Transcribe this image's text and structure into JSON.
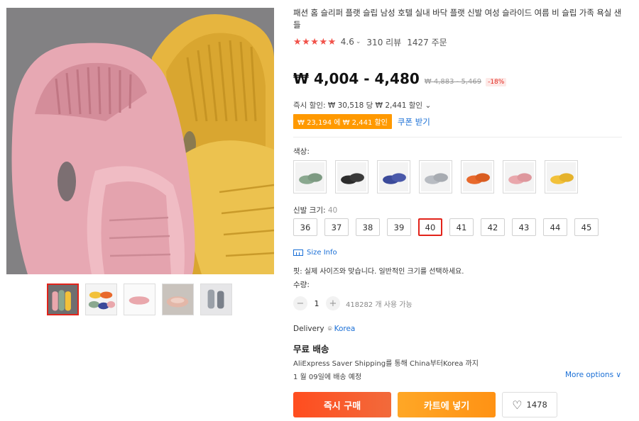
{
  "product": {
    "title": "패션 홈 슬리퍼 플랫 슬립 남성 호텔 실내 바닥 플랫 신발 여성 슬라이드 여름 비 슬립 가족 욕실 샌들",
    "stars_icon": "star-icon",
    "rating": "4.6",
    "reviews": "310 리뷰",
    "orders": "1427 주문"
  },
  "price": {
    "current": "₩ 4,004 - 4,480",
    "original": "₩ 4,883 - 5,469",
    "discount": "-18%",
    "instant_discount": "즉시 할인: ₩ 30,518 당 ₩ 2,441 할인",
    "coupon_tag": "₩ 23,194 에 ₩ 2,441 할인",
    "coupon_link": "쿠폰 받기",
    "accent_color": "#e2231a",
    "coupon_color": "#ff9900"
  },
  "color": {
    "label": "색상:",
    "options": [
      {
        "name": "green",
        "color": "#8aa88f"
      },
      {
        "name": "black",
        "color": "#2b2b2b"
      },
      {
        "name": "navy",
        "color": "#3b4a9a"
      },
      {
        "name": "grey",
        "color": "#b8bcc2"
      },
      {
        "name": "orange",
        "color": "#e8692c"
      },
      {
        "name": "pink",
        "color": "#e9a7ac"
      },
      {
        "name": "yellow",
        "color": "#f2c13a"
      }
    ]
  },
  "size": {
    "label": "신발 크기: ",
    "selected": "40",
    "options": [
      "36",
      "37",
      "38",
      "39",
      "40",
      "41",
      "42",
      "43",
      "44",
      "45"
    ],
    "info_link": "Size Info",
    "fit_note": "핏: 실제 사이즈와 맞습니다. 일반적인 크기를 선택하세요."
  },
  "quantity": {
    "label": "수량:",
    "value": "1",
    "minus": "−",
    "plus": "+",
    "available": "418282 개 사용 가능"
  },
  "delivery": {
    "label": "Delivery",
    "location": "Korea",
    "free_shipping": "무료 배송",
    "via": "AliExpress Saver Shipping를 통해 China부터Korea 까지",
    "date": "1 월 09일에 배송 예정",
    "more_options": "More options ∨"
  },
  "actions": {
    "buy_now": "즉시 구매",
    "add_to_cart": "카트에 넣기",
    "wishlist_count": "1478"
  }
}
